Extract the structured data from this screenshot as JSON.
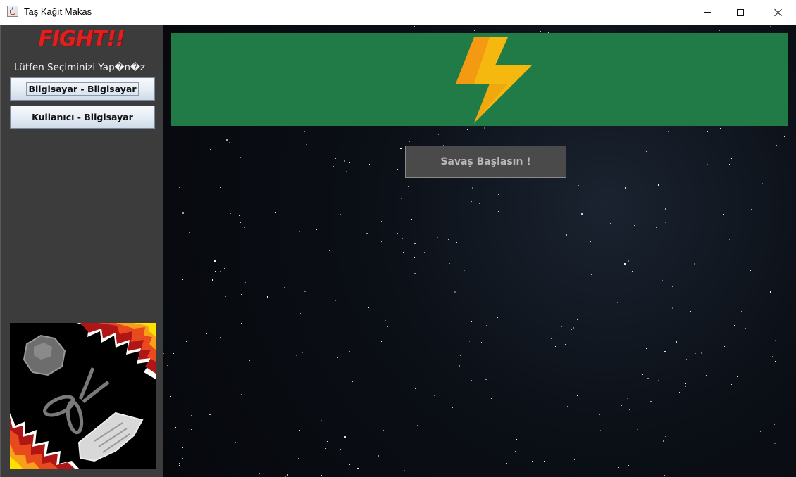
{
  "window": {
    "title": "Taş Kağıt Makas",
    "controls": [
      "minimize-icon",
      "maximize-icon",
      "close-icon"
    ]
  },
  "sidebar": {
    "heading": "FIGHT!!",
    "prompt": "Lütfen Seçiminizi Yap�n�z",
    "buttons": [
      {
        "label": "Bilgisayar - Bilgisayar"
      },
      {
        "label": "Kullanıcı - Bilgisayar"
      }
    ],
    "image_icon": "rock-scissors-paper-icon"
  },
  "main": {
    "banner_icon": "lightning-bolt-icon",
    "start_label": "Savaş Başlasın !"
  },
  "colors": {
    "sidebar_bg": "#3c3c3c",
    "banner_green": "#217b47",
    "heading_red": "#e01f1f",
    "start_button_bg": "#4a4a4a"
  }
}
